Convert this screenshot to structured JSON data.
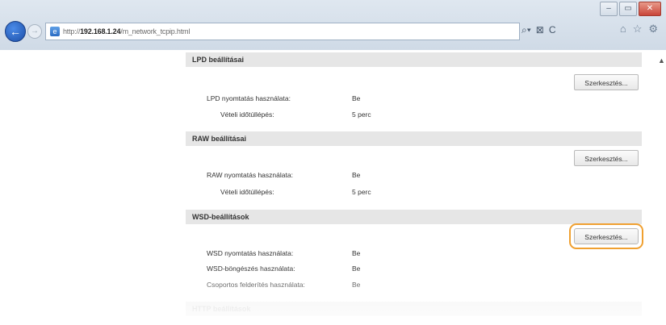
{
  "browser": {
    "url_prefix": "http://",
    "url_host": "192.168.1.24",
    "url_path": "/m_network_tcpip.html",
    "addr_tools": [
      "⌕▾",
      "⊠",
      "C"
    ],
    "fav_tools": [
      "⌂",
      "☆",
      "⚙"
    ]
  },
  "sections": [
    {
      "title": "LPD beállításai",
      "edit_label": "Szerkesztés...",
      "rows": [
        {
          "label": "LPD nyomtatás használata:",
          "value": "Be"
        },
        {
          "label": "Vételi időtúllépés:",
          "value": "5 perc"
        }
      ]
    },
    {
      "title": "RAW beállításai",
      "edit_label": "Szerkesztés...",
      "rows": [
        {
          "label": "RAW nyomtatás használata:",
          "value": "Be"
        },
        {
          "label": "Vételi időtúllépés:",
          "value": "5 perc"
        }
      ]
    },
    {
      "title": "WSD-beállítások",
      "edit_label": "Szerkesztés...",
      "rows": [
        {
          "label": "WSD nyomtatás használata:",
          "value": "Be"
        },
        {
          "label": "WSD-böngészés használata:",
          "value": "Be"
        },
        {
          "label": "Csoportos felderítés használata:",
          "value": "Be"
        }
      ]
    },
    {
      "title": "HTTP beállítások"
    }
  ],
  "colors": {
    "highlight": "#f0a030",
    "section_bg": "#e6e6e6"
  }
}
